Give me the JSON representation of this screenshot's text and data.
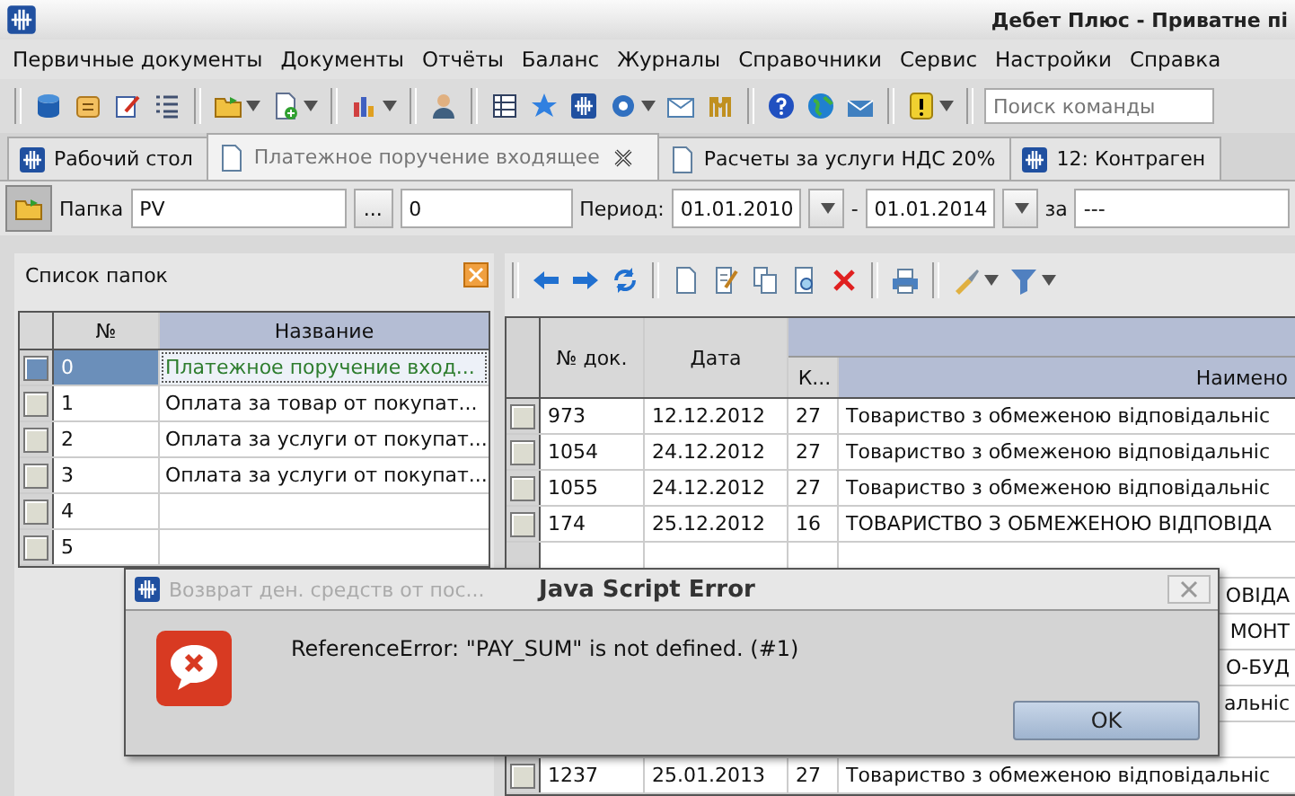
{
  "window": {
    "title": "Дебет Плюс - Приватне пі"
  },
  "menu": [
    "Первичные документы",
    "Документы",
    "Отчёты",
    "Баланс",
    "Журналы",
    "Справочники",
    "Сервис",
    "Настройки",
    "Справка"
  ],
  "toolbar": {
    "search": {
      "placeholder": "Поиск команды"
    }
  },
  "tabs": [
    {
      "label": "Рабочий стол",
      "kind": "app",
      "selected": false,
      "closable": false
    },
    {
      "label": "Платежное поручение входящее",
      "kind": "document",
      "selected": true,
      "closable": true
    },
    {
      "label": "Расчеты за услуги НДС 20%",
      "kind": "document",
      "selected": false,
      "closable": false
    },
    {
      "label": "12: Контраген",
      "kind": "app",
      "selected": false,
      "closable": false
    }
  ],
  "filter": {
    "folder_label": "Папка",
    "folder_value": "PV",
    "browse_button": "...",
    "folder_number": "0",
    "period_label": "Период:",
    "date_from": "01.01.2010",
    "separator": "-",
    "date_to": "01.01.2014",
    "for_label": "за",
    "for_value": "---"
  },
  "folders_panel": {
    "title": "Список папок",
    "columns": [
      "№",
      "Название"
    ],
    "rows": [
      {
        "number": "0",
        "name": "Платежное поручение вход...",
        "selected": true
      },
      {
        "number": "1",
        "name": "Оплата за товар от покупат...",
        "selected": false
      },
      {
        "number": "2",
        "name": "Оплата за услуги от покупат...",
        "selected": false
      },
      {
        "number": "3",
        "name": "Оплата за услуги от покупат...",
        "selected": false
      },
      {
        "number": "4",
        "selected": false
      },
      {
        "number": "5",
        "selected": false
      }
    ]
  },
  "documents": {
    "columns": [
      "№ док.",
      "Дата"
    ],
    "subcolumns": [
      "К...",
      "Наимено"
    ],
    "rows": [
      {
        "kind": "full",
        "number": "973",
        "date": "12.12.2012",
        "code": "27",
        "name": "Товариство з обмеженою відповідальніс"
      },
      {
        "kind": "full",
        "number": "1054",
        "date": "24.12.2012",
        "code": "27",
        "name": "Товариство з обмеженою відповідальніс"
      },
      {
        "kind": "full",
        "number": "1055",
        "date": "24.12.2012",
        "code": "27",
        "name": "Товариство з обмеженою відповідальніс"
      },
      {
        "kind": "full",
        "number": "174",
        "date": "25.12.2012",
        "code": "16",
        "name": "ТОВАРИСТВО З ОБМЕЖЕНОЮ ВІДПОВІДА"
      },
      {
        "kind": "covered"
      },
      {
        "kind": "covered",
        "name": "ОВІДА"
      },
      {
        "kind": "covered",
        "name": "МОНТ"
      },
      {
        "kind": "covered",
        "name": "О-БУД"
      },
      {
        "kind": "covered",
        "name": "альніс"
      },
      {
        "kind": "covered"
      },
      {
        "kind": "full",
        "number": "1237",
        "date": "25.01.2013",
        "code": "27",
        "name": "Товариство з обмеженою відповідальніс"
      }
    ]
  },
  "dialog": {
    "window_caption": "Возврат ден. средств от пос...",
    "title": "Java Script Error",
    "message": "ReferenceError: \"PAY_SUM\" is not defined. (#1)",
    "button": "OK"
  }
}
